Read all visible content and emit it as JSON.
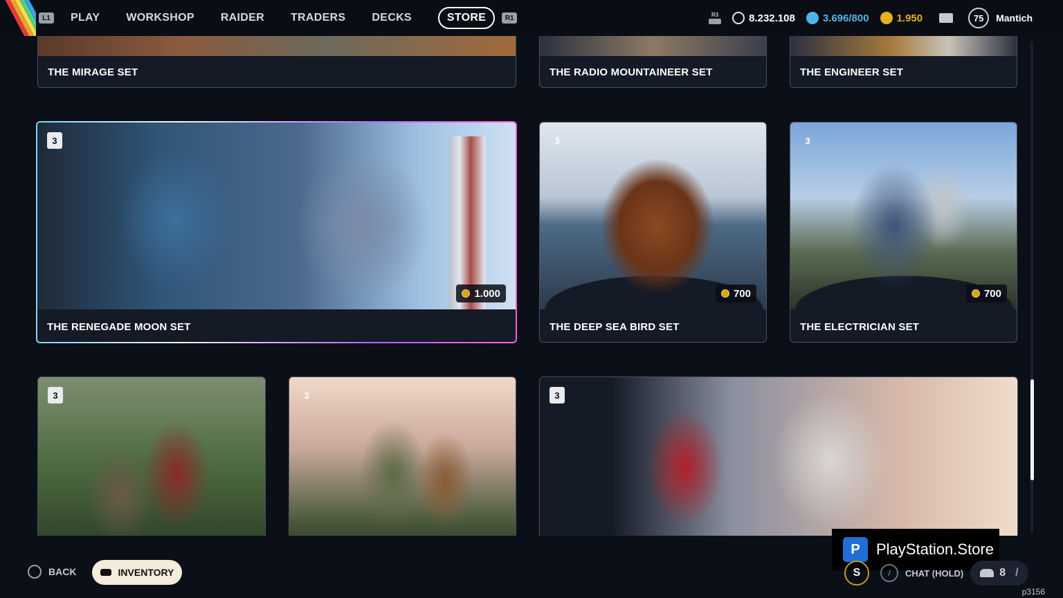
{
  "topbar": {
    "l1_hint": "L1",
    "r1_hint": "R1",
    "nav": [
      "PLAY",
      "WORKSHOP",
      "RAIDER",
      "TRADERS",
      "DECKS"
    ],
    "active_tab": "STORE",
    "r3_hint": "R3",
    "currency": {
      "coins": "8.232.108",
      "cred": "3.696/800",
      "raider_tokens": "1.950"
    },
    "level": "75",
    "username": "Mantich"
  },
  "cards": [
    {
      "title": "THE MIRAGE SET"
    },
    {
      "title": "THE RADIO MOUNTAINEER SET"
    },
    {
      "title": "THE ENGINEER SET"
    },
    {
      "title": "THE RENEGADE MOON SET",
      "count": "3",
      "price": "1.000"
    },
    {
      "title": "THE DEEP SEA BIRD SET",
      "count": "3",
      "price": "700"
    },
    {
      "title": "THE ELECTRICIAN SET",
      "count": "3",
      "price": "700"
    },
    {
      "count": "3"
    },
    {
      "count": "3"
    },
    {
      "count": "3"
    }
  ],
  "bottombar": {
    "back_label": "BACK",
    "inventory_label": "INVENTORY",
    "ps_store_label": "PlayStation.Store",
    "chat_label": "CHAT (HOLD)",
    "friends_count": "8",
    "build_id": "p3156"
  },
  "colors": {
    "background": "#0b0f18",
    "card": "#141a26",
    "cred": "#4fb3e8",
    "token": "#e4b21d",
    "focus_gradient": [
      "#7fd6ff",
      "#b764ff",
      "#ff5fd2"
    ]
  }
}
